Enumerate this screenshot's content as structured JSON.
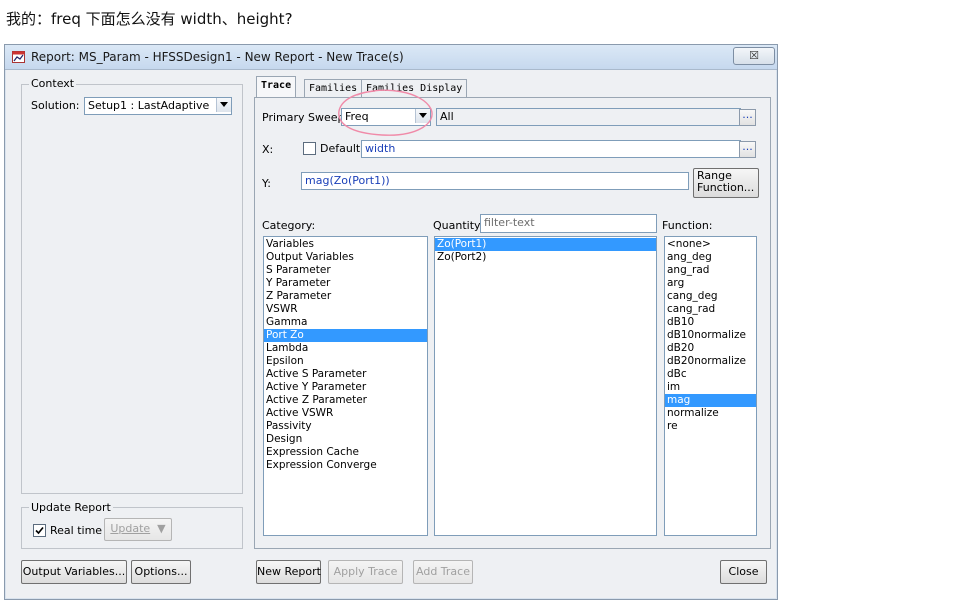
{
  "question": "我的：freq 下面怎么没有 width、height?",
  "window": {
    "title": "Report: MS_Param - HFSSDesign1 - New Report - New Trace(s)",
    "close_label": "☒"
  },
  "context": {
    "group_label": "Context",
    "solution_label": "Solution:",
    "solution_value": "Setup1 : LastAdaptive"
  },
  "update_report": {
    "group_label": "Update Report",
    "realtime_label": "Real time",
    "realtime_checked": true,
    "update_button": "Update"
  },
  "tabs": [
    "Trace",
    "Families",
    "Families Display"
  ],
  "trace": {
    "primary_sweep_label": "Primary Sweep:",
    "primary_sweep_value": "Freq",
    "sweep_values": "All",
    "x_label": "X:",
    "default_label": "Default",
    "x_value": "width",
    "y_label": "Y:",
    "y_value": "mag(Zo(Port1))",
    "range_function_line1": "Range",
    "range_function_line2": "Function...",
    "ellipsis": "..."
  },
  "category": {
    "label": "Category:",
    "items": [
      "Variables",
      "Output Variables",
      "S Parameter",
      "Y Parameter",
      "Z Parameter",
      "VSWR",
      "Gamma",
      "Port Zo",
      "Lambda",
      "Epsilon",
      "Active S Parameter",
      "Active Y Parameter",
      "Active Z Parameter",
      "Active VSWR",
      "Passivity",
      "Design",
      "Expression Cache",
      "Expression Converge"
    ],
    "selected": "Port Zo"
  },
  "quantity": {
    "label": "Quantity:",
    "filter_placeholder": "filter-text",
    "items": [
      "Zo(Port1)",
      "Zo(Port2)"
    ],
    "selected": "Zo(Port1)"
  },
  "function": {
    "label": "Function:",
    "items": [
      "<none>",
      "ang_deg",
      "ang_rad",
      "arg",
      "cang_deg",
      "cang_rad",
      "dB10",
      "dB10normalize",
      "dB20",
      "dB20normalize",
      "dBc",
      "im",
      "mag",
      "normalize",
      "re"
    ],
    "selected": "mag"
  },
  "bottom_buttons": {
    "output_variables": "Output Variables...",
    "options": "Options...",
    "new_report": "New Report",
    "apply_trace": "Apply Trace",
    "add_trace": "Add Trace",
    "close": "Close"
  },
  "colors": {
    "annotation_circle": "#f08aa8",
    "selection": "#3399ff",
    "field_text": "#1a3fb8"
  }
}
